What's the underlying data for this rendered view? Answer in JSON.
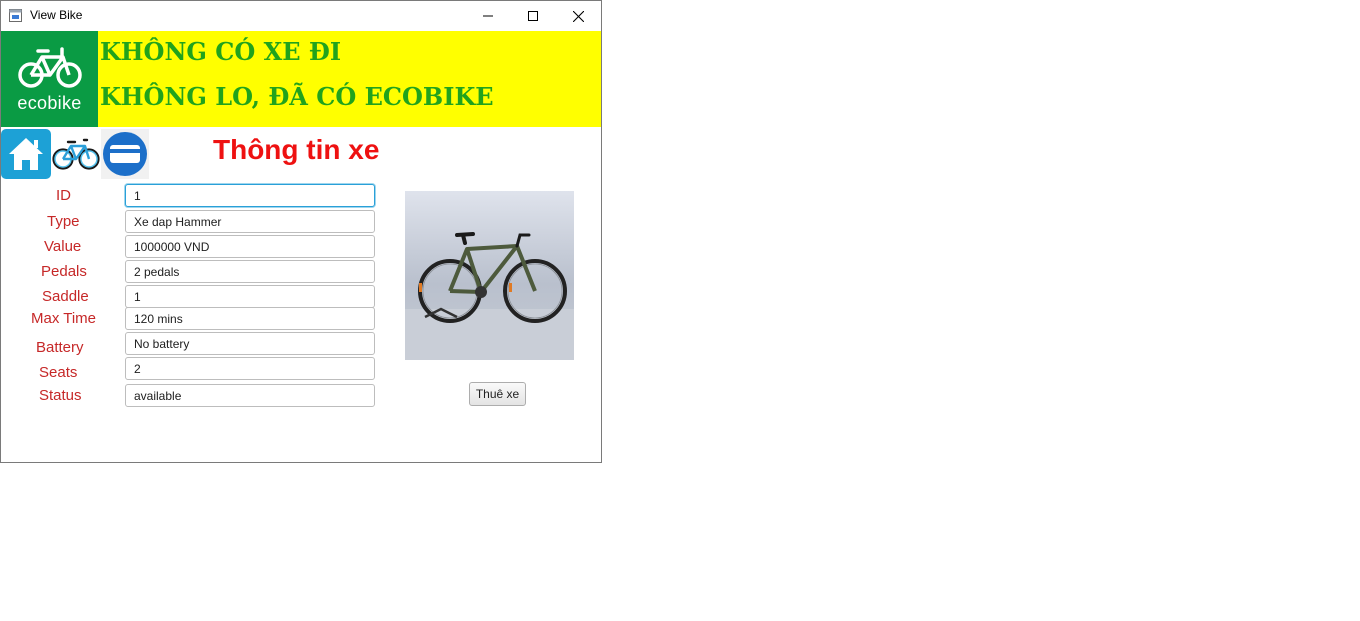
{
  "window": {
    "title": "View Bike"
  },
  "banner": {
    "logo_text": "ecobike",
    "slogan_line1": "KHÔNG CÓ XE ĐI",
    "slogan_line2": "KHÔNG LO, ĐÃ CÓ ECOBIKE",
    "background_color": "#ffff00",
    "slogan_color": "#21a31c",
    "logo_color": "#0a9b44"
  },
  "nav": {
    "icons": [
      "home-icon",
      "bicycle-icon",
      "card-icon"
    ]
  },
  "page": {
    "title": "Thông tin xe",
    "title_color": "#ee1111"
  },
  "form": {
    "fields": [
      {
        "label": "ID",
        "value": "1"
      },
      {
        "label": "Type",
        "value": "Xe dap Hammer"
      },
      {
        "label": "Value",
        "value": "1000000 VND"
      },
      {
        "label": "Pedals",
        "value": "2 pedals"
      },
      {
        "label": "Saddle",
        "value": "1"
      },
      {
        "label": "Max Time",
        "value": "120 mins"
      },
      {
        "label": "Battery",
        "value": "No battery"
      },
      {
        "label": "Seats",
        "value": "2"
      },
      {
        "label": "Status",
        "value": "available"
      }
    ]
  },
  "actions": {
    "rent_label": "Thuê xe"
  }
}
